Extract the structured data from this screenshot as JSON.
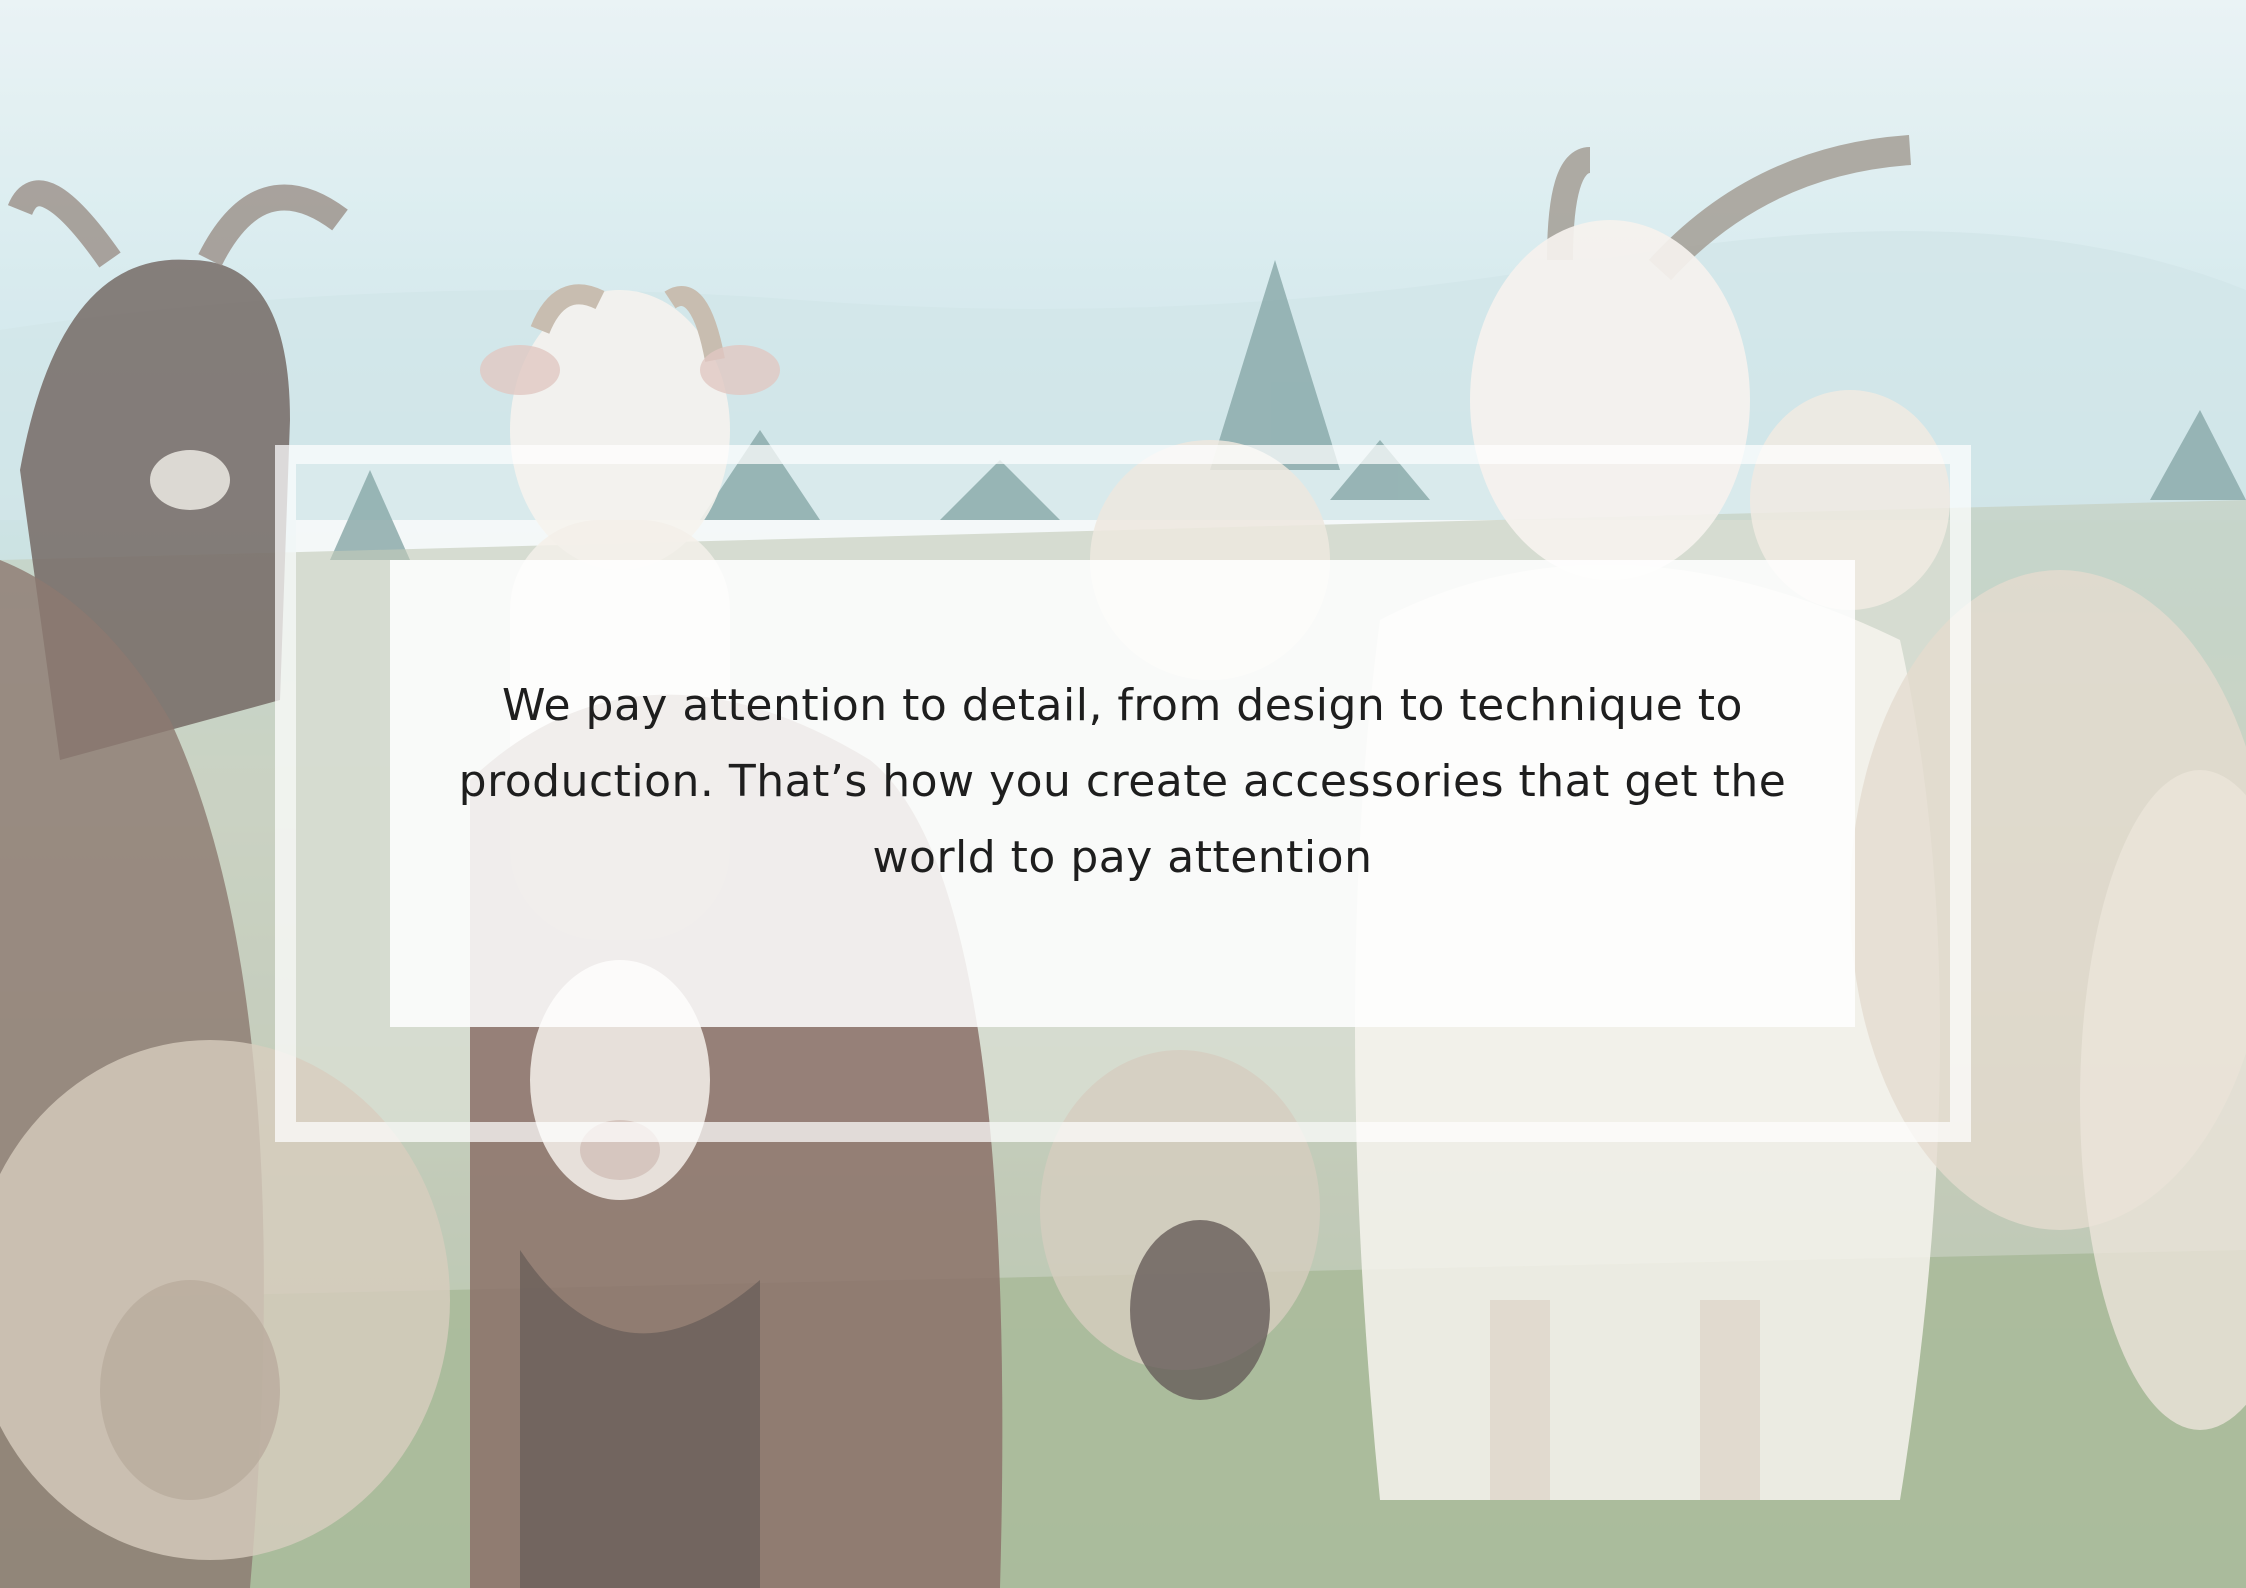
{
  "quote": {
    "text": "We pay attention to detail, from design to technique to production. That’s how you create accessories that get the world to pay attention"
  },
  "background": {
    "subject": "herd of goats and sheep grazing in a green meadow",
    "palette": {
      "sky": "#d2e8ec",
      "trees": "#5f8a8a",
      "grass": "#94aa84",
      "white_wool": "#f1ede6",
      "brown_wool": "#7a5a4e",
      "dark_coat": "#4a3a34"
    }
  },
  "overlay": {
    "frame_color": "#ffffff",
    "text_color": "#1e1e1e"
  }
}
